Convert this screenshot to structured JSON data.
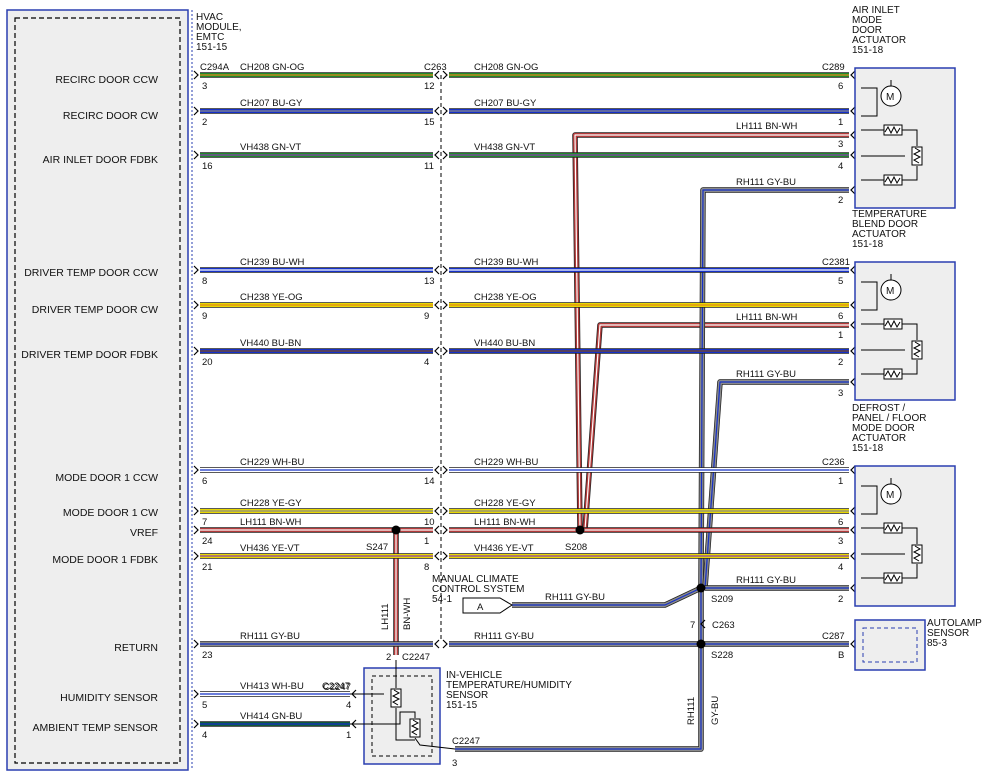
{
  "module": {
    "title": [
      "HVAC",
      "MODULE,",
      "EMTC",
      "151-15"
    ]
  },
  "colors": {
    "GN-OG": [
      "#1f8a2a",
      "#e08a1a"
    ],
    "BU-GY": [
      "#1530c8",
      "#8a8a8a"
    ],
    "GN-VT": [
      "#1f8a2a",
      "#8a3fb0"
    ],
    "BU-WH": [
      "#1530c8",
      "#ffffff"
    ],
    "YE-OG": [
      "#e8d800",
      "#e08a1a"
    ],
    "BU-BN": [
      "#1530c8",
      "#7a4a20"
    ],
    "WH-BU": [
      "#ffffff",
      "#1530c8"
    ],
    "YE-GY": [
      "#e8d800",
      "#8a8a8a"
    ],
    "BN-WH": [
      "#b33a3a",
      "#ffffff"
    ],
    "YE-VT": [
      "#e8d800",
      "#8a3fb0"
    ],
    "GY-BU": [
      "#8a8a8a",
      "#1530c8"
    ],
    "GN-BU": [
      "#0f5a3a",
      "#1530c8"
    ]
  },
  "pin_labels": [
    "RECIRC DOOR CCW",
    "RECIRC DOOR CW",
    "AIR INLET DOOR FDBK",
    "DRIVER TEMP DOOR CCW",
    "DRIVER TEMP DOOR CW",
    "DRIVER TEMP DOOR FDBK",
    "MODE DOOR 1 CCW",
    "MODE DOOR 1 CW",
    "VREF",
    "MODE DOOR 1 FDBK",
    "RETURN",
    "HUMIDITY SENSOR",
    "AMBIENT TEMP SENSOR"
  ],
  "wires": [
    {
      "circuit": "CH208",
      "color": "GN-OG",
      "pin_left": "3",
      "connector_left": "C294A",
      "pin_mid": "12",
      "connector_mid": "C263",
      "pin_right": "6",
      "connector_right": "C289"
    },
    {
      "circuit": "CH207",
      "color": "BU-GY",
      "pin_left": "2",
      "pin_mid": "15",
      "pin_right": "1"
    },
    {
      "circuit": "VH438",
      "color": "GN-VT",
      "pin_left": "16",
      "pin_mid": "11",
      "pin_right": "4"
    },
    {
      "circuit": "CH239",
      "color": "BU-WH",
      "pin_left": "8",
      "pin_mid": "13",
      "pin_right": "5",
      "connector_right": "C2381"
    },
    {
      "circuit": "CH238",
      "color": "YE-OG",
      "pin_left": "9",
      "pin_mid": "9",
      "pin_right": "6"
    },
    {
      "circuit": "VH440",
      "color": "BU-BN",
      "pin_left": "20",
      "pin_mid": "4",
      "pin_right": "2"
    },
    {
      "circuit": "CH229",
      "color": "WH-BU",
      "pin_left": "6",
      "pin_mid": "14",
      "pin_right": "1",
      "connector_right": "C236"
    },
    {
      "circuit": "CH228",
      "color": "YE-GY",
      "pin_left": "7",
      "pin_mid": "",
      "pin_right": "6"
    },
    {
      "circuit": "LH111",
      "color": "BN-WH",
      "pin_left": "24",
      "pin_mid": "1",
      "pin_right": "3"
    },
    {
      "circuit": "VH436",
      "color": "YE-VT",
      "pin_left": "21",
      "pin_mid": "8",
      "pin_right": "4"
    },
    {
      "circuit": "RH111",
      "color": "GY-BU",
      "pin_left": "23",
      "pin_right": "B",
      "connector_right": "C287"
    },
    {
      "circuit": "VH413",
      "color": "WH-BU",
      "pin_left": "5",
      "pin_right": "4",
      "connector_right": "C2247"
    },
    {
      "circuit": "VH414",
      "color": "GN-BU",
      "pin_left": "4",
      "pin_right": "1"
    }
  ],
  "mid_pin_extra": "10",
  "branch_wires": {
    "lh111": {
      "circuit": "LH111",
      "color": "BN-WH"
    },
    "rh111": {
      "circuit": "RH111",
      "color": "GY-BU"
    },
    "lh111_pins": [
      "3",
      "1"
    ],
    "rh111_pins": [
      "2",
      "3",
      "2"
    ]
  },
  "splices": [
    "S247",
    "S208",
    "S209",
    "S228"
  ],
  "components": {
    "air_inlet": {
      "title": [
        "AIR INLET",
        "MODE",
        "DOOR",
        "ACTUATOR",
        "151-18"
      ]
    },
    "temp_blend": {
      "title": [
        "TEMPERATURE",
        "BLEND DOOR",
        "ACTUATOR",
        "151-18"
      ]
    },
    "defrost": {
      "title": [
        "DEFROST /",
        "PANEL / FLOOR",
        "MODE DOOR",
        "ACTUATOR",
        "151-18"
      ]
    },
    "autolamp": {
      "title": [
        "AUTOLAMP",
        "SENSOR",
        "85-3"
      ]
    },
    "in_vehicle": {
      "title": [
        "IN-VEHICLE",
        "TEMPERATURE/HUMIDITY",
        "SENSOR",
        "151-15"
      ]
    },
    "manual_climate": {
      "title": [
        "MANUAL CLIMATE",
        "CONTROL SYSTEM",
        "54-1"
      ],
      "ref": "A"
    }
  },
  "motor_symbol": "M",
  "vertical_wires": {
    "s247_drop": {
      "circuit": "LH111",
      "color": "BN-WH",
      "connector": "C2247",
      "pin": "2"
    },
    "s228_drop": {
      "circuit": "RH111",
      "color": "GY-BU",
      "connector": "C2247",
      "pin": "3"
    },
    "s209_drop": {
      "connector": "C263",
      "pin": "7"
    }
  }
}
